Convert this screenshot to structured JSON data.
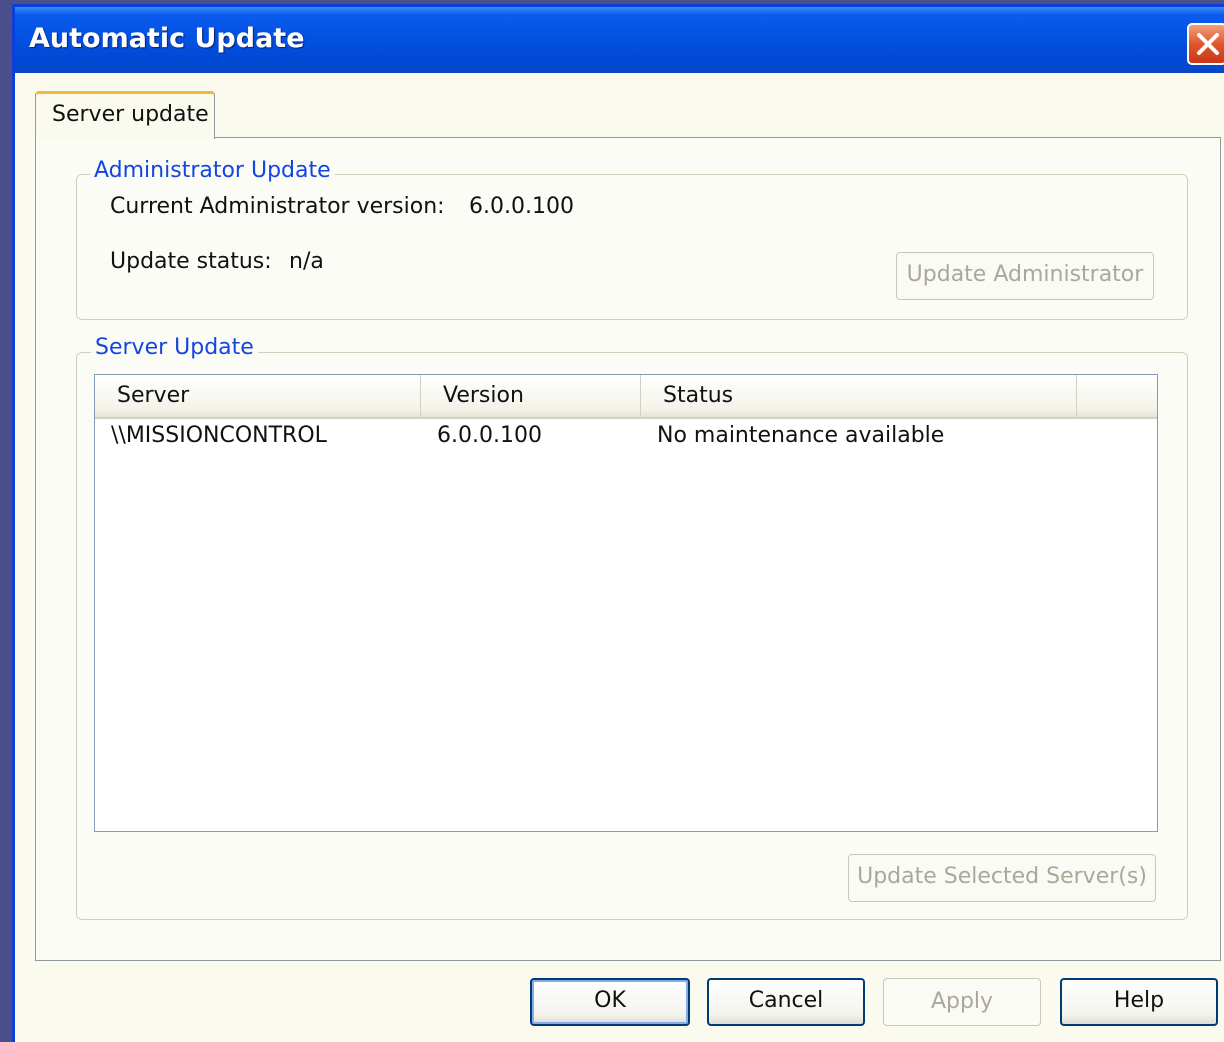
{
  "window": {
    "title": "Automatic Update"
  },
  "tabs": [
    {
      "label": "Server update",
      "selected": true
    }
  ],
  "admin_update": {
    "legend": "Administrator Update",
    "version_label": "Current Administrator version:",
    "version_value": "6.0.0.100",
    "status_label": "Update status:",
    "status_value": "n/a",
    "button_label": "Update Administrator"
  },
  "server_update": {
    "legend": "Server Update",
    "columns": [
      "Server",
      "Version",
      "Status"
    ],
    "rows": [
      {
        "server": "\\\\MISSIONCONTROL",
        "version": "6.0.0.100",
        "status": "No maintenance available"
      }
    ],
    "button_label": "Update Selected Server(s)"
  },
  "footer": {
    "ok_label": "OK",
    "cancel_label": "Cancel",
    "apply_label": "Apply",
    "help_label": "Help"
  },
  "colors": {
    "titlebar_blue": "#0350e0",
    "group_legend_blue": "#1445e0",
    "tab_accent_orange": "#f5b63c",
    "close_red": "#e2552b",
    "disabled_text": "#aca899"
  },
  "icons": {
    "close": "close-icon"
  }
}
